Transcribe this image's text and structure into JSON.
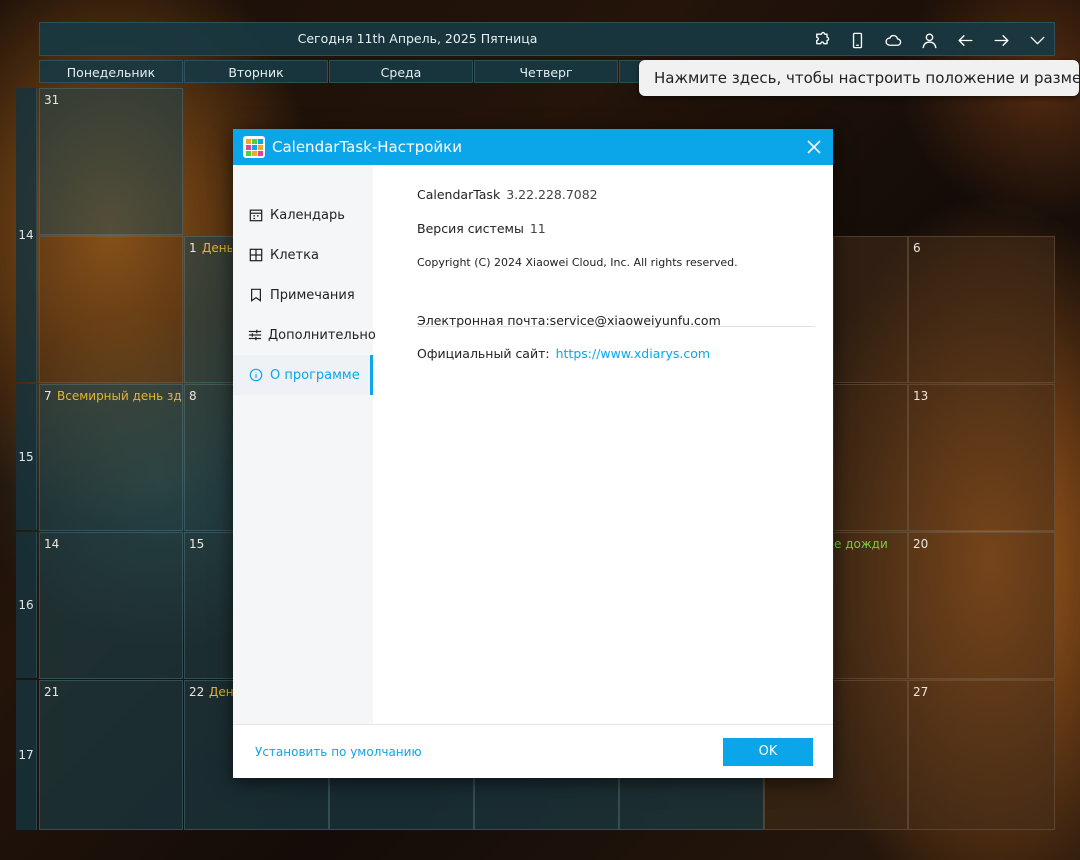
{
  "topbar": {
    "today_label": "Сегодня 11th Апрель, 2025 Пятница",
    "icons": [
      "puzzle-icon",
      "phone-icon",
      "cloud-icon",
      "user-icon",
      "arrow-left-icon",
      "arrow-right-icon",
      "chevron-down-icon"
    ]
  },
  "weekdays": [
    "Понедельник",
    "Вторник",
    "Среда",
    "Четверг"
  ],
  "tooltip": "Нажмите здесь, чтобы настроить положение и размер",
  "weeks": [
    "14",
    "15",
    "16",
    "17"
  ],
  "cells": {
    "d31": "31",
    "d1": "1",
    "d1_event": "День д",
    "d6": "6",
    "d7": "7",
    "d7_event": "Всемирный день здор",
    "d8": "8",
    "d13": "13",
    "d14": "14",
    "d15": "15",
    "d19_event": "е дожди",
    "d20": "20",
    "d21": "21",
    "d22": "22",
    "d22_event": "День",
    "d27": "27"
  },
  "dialog": {
    "title": "CalendarTask-Настройки",
    "nav": [
      {
        "label": "Календарь",
        "icon": "calendar-icon"
      },
      {
        "label": "Клетка",
        "icon": "grid-icon"
      },
      {
        "label": "Примечания",
        "icon": "bookmark-icon"
      },
      {
        "label": "Дополнительно",
        "icon": "sliders-icon"
      },
      {
        "label": "О программе",
        "icon": "info-icon",
        "active": true
      }
    ],
    "app_name": "CalendarTask",
    "app_version": "3.22.228.7082",
    "system_version_label": "Версия системы",
    "system_version_value": "11",
    "copyright": "Copyright (C) 2024 Xiaowei Cloud, Inc. All rights reserved.",
    "email_label": "Электронная почта:service@xiaoweiyunfu.com",
    "site_label": "Официальный сайт:",
    "site_link": "https://www.xdiarys.com",
    "reset_label": "Установить по умолчанию",
    "ok_label": "OK"
  },
  "colors": {
    "accent": "#0ba6e9",
    "event_yellow": "#e6b531",
    "event_green": "#6fd13c"
  }
}
